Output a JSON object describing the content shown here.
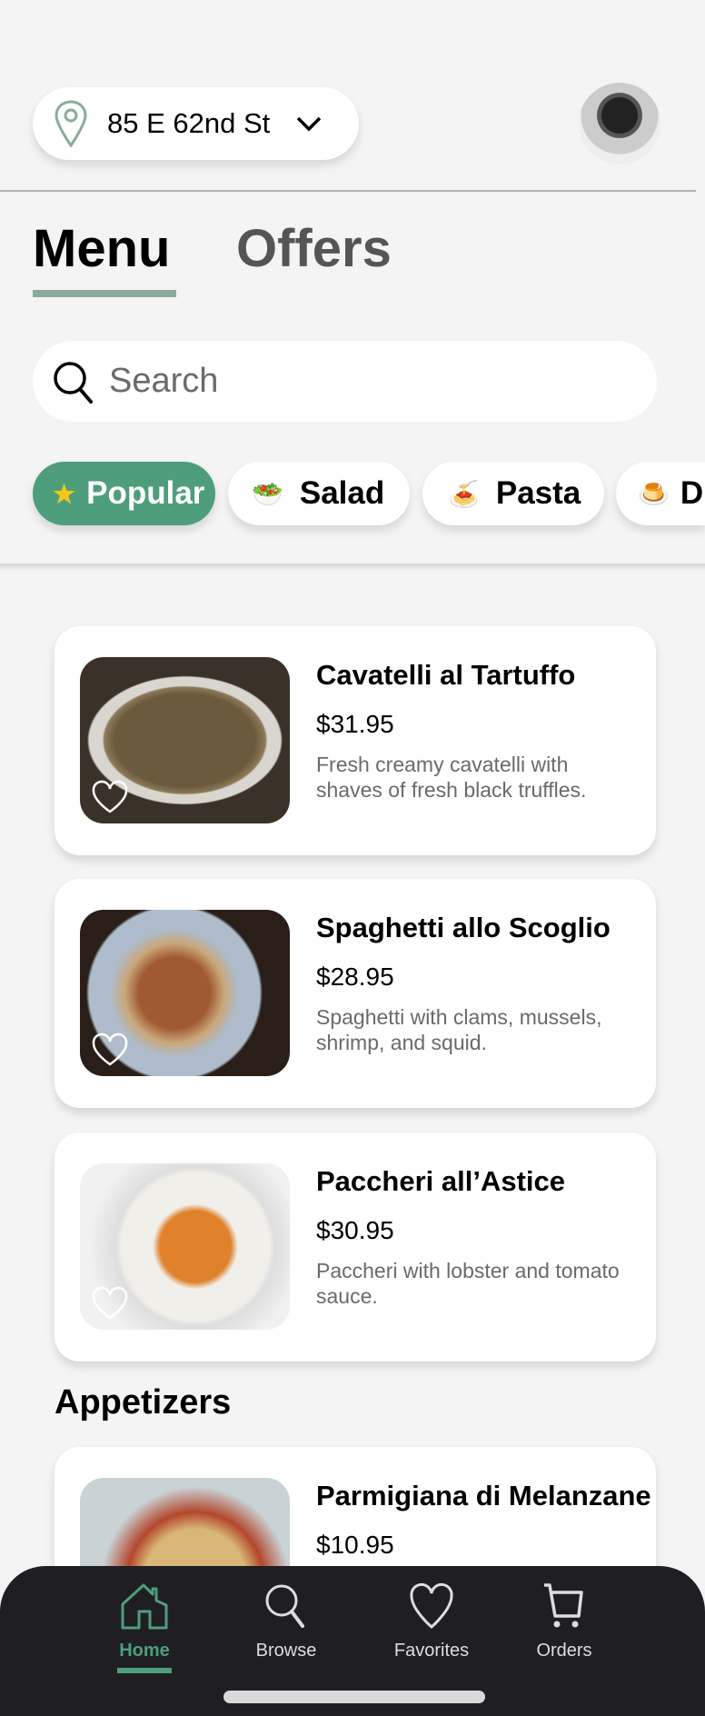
{
  "header": {
    "location": "85 E 62nd St"
  },
  "tabs": [
    {
      "label": "Menu",
      "active": true
    },
    {
      "label": "Offers",
      "active": false
    }
  ],
  "search": {
    "placeholder": "Search"
  },
  "categories": [
    {
      "label": "Popular",
      "icon": "star-icon",
      "active": true
    },
    {
      "label": "Salad",
      "icon": "salad-icon"
    },
    {
      "label": "Pasta",
      "icon": "pasta-icon"
    },
    {
      "label": "D",
      "icon": "dessert-icon"
    }
  ],
  "items": [
    {
      "title": "Cavatelli al Tartuffo",
      "price": "$31.95",
      "desc": "Fresh creamy cavatelli with shaves of fresh black truffles."
    },
    {
      "title": "Spaghetti allo Scoglio",
      "price": "$28.95",
      "desc": "Spaghetti with clams, mussels, shrimp, and squid."
    },
    {
      "title": "Paccheri all’Astice",
      "price": "$30.95",
      "desc": "Paccheri with lobster and tomato sauce."
    }
  ],
  "section": "Appetizers",
  "appetizers": [
    {
      "title": "Parmigiana di Melanzane",
      "price": "$10.95"
    }
  ],
  "nav": [
    {
      "label": "Home",
      "active": true
    },
    {
      "label": "Browse"
    },
    {
      "label": "Favorites"
    },
    {
      "label": "Orders"
    }
  ],
  "colors": {
    "accent": "#4e9e7c",
    "nav_bg": "#1f1f23",
    "tab_underline": "#8aac9a"
  }
}
